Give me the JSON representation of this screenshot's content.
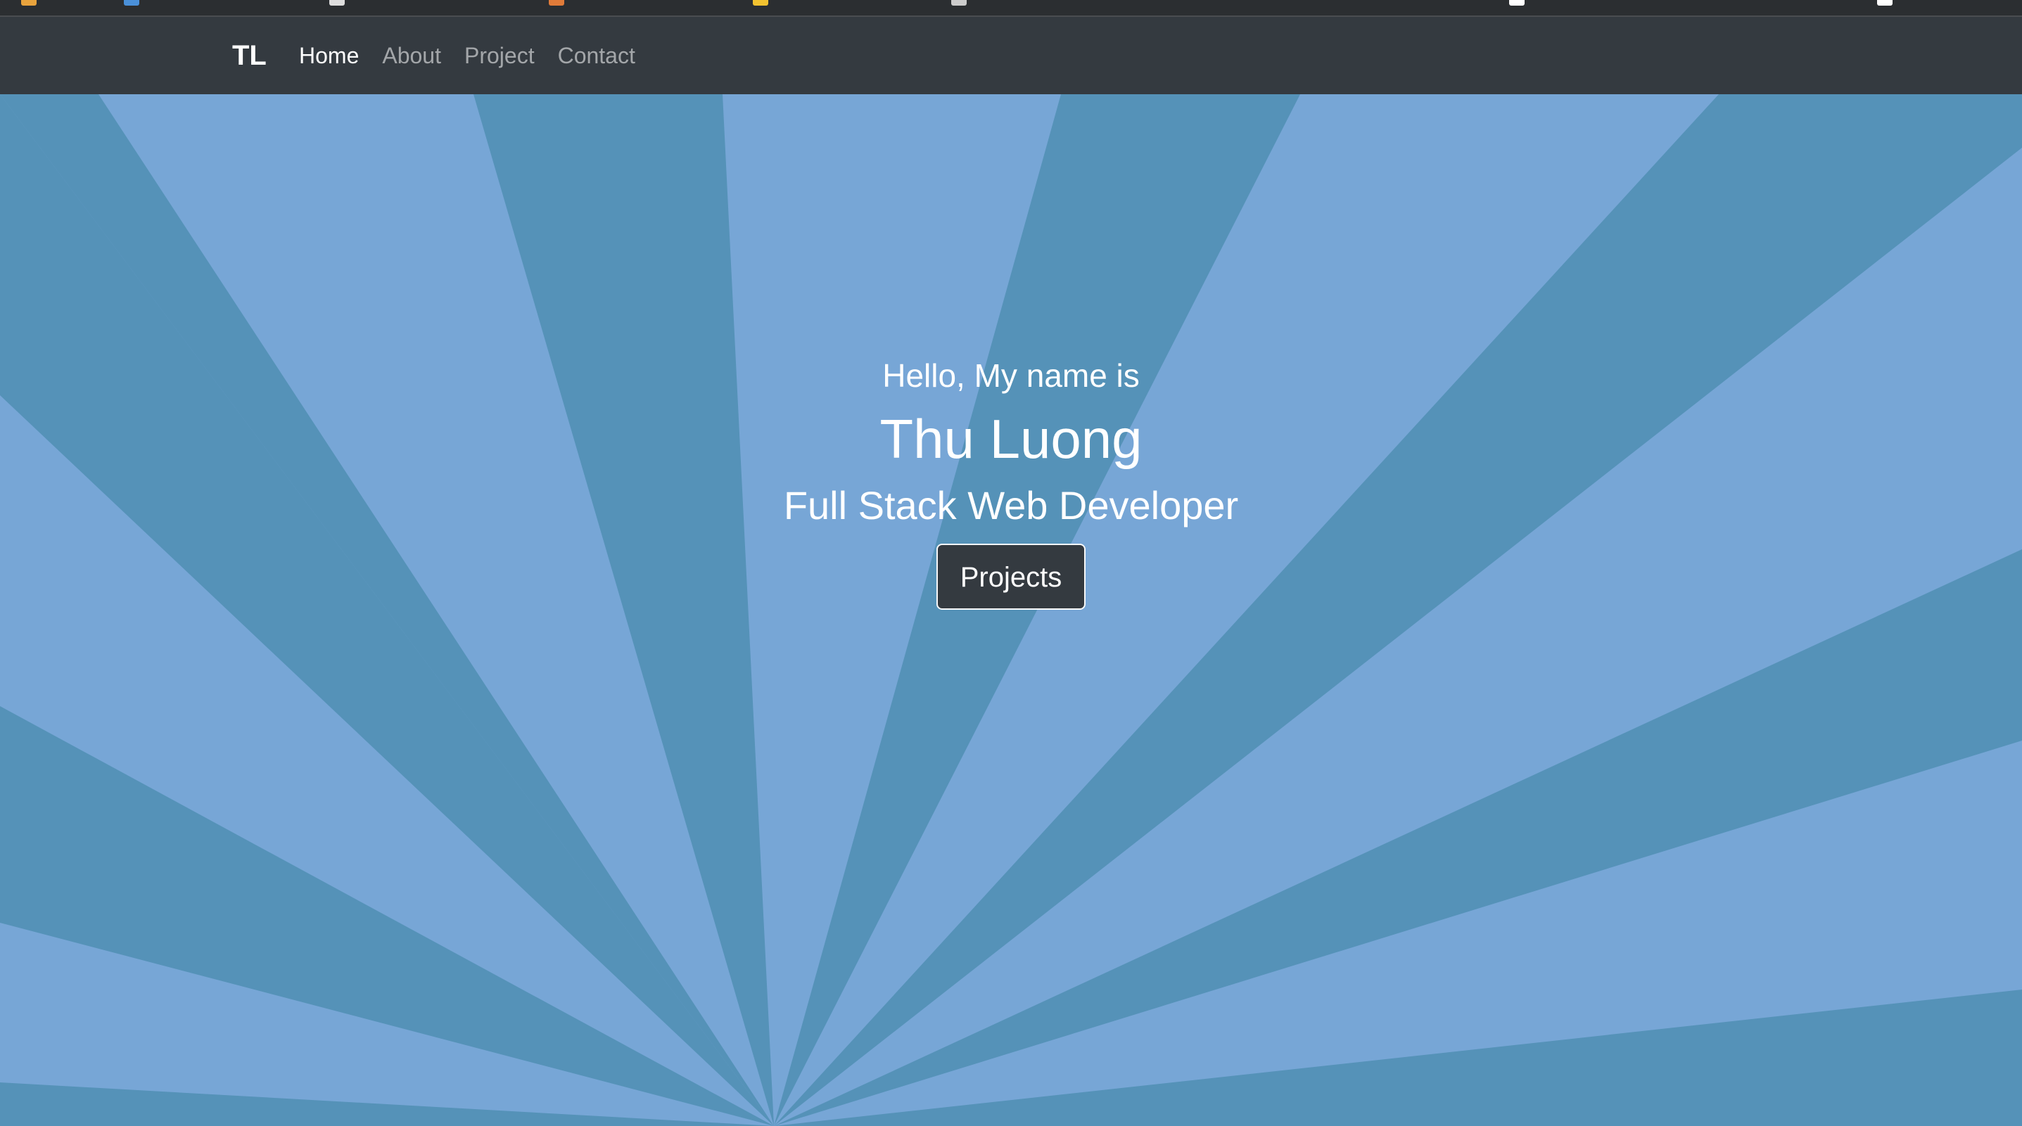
{
  "navbar": {
    "brand": "TL",
    "links": [
      {
        "label": "Home",
        "active": true
      },
      {
        "label": "About",
        "active": false
      },
      {
        "label": "Project",
        "active": false
      },
      {
        "label": "Contact",
        "active": false
      }
    ]
  },
  "hero": {
    "greeting": "Hello, My name is",
    "name": "Thu Luong",
    "role": "Full Stack Web Developer",
    "button_label": "Projects"
  },
  "colors": {
    "navbar_bg": "#343a40",
    "ray_light": "#77a6d6",
    "ray_dark": "#5592b8",
    "button_bg": "#343a40",
    "text": "#ffffff"
  }
}
